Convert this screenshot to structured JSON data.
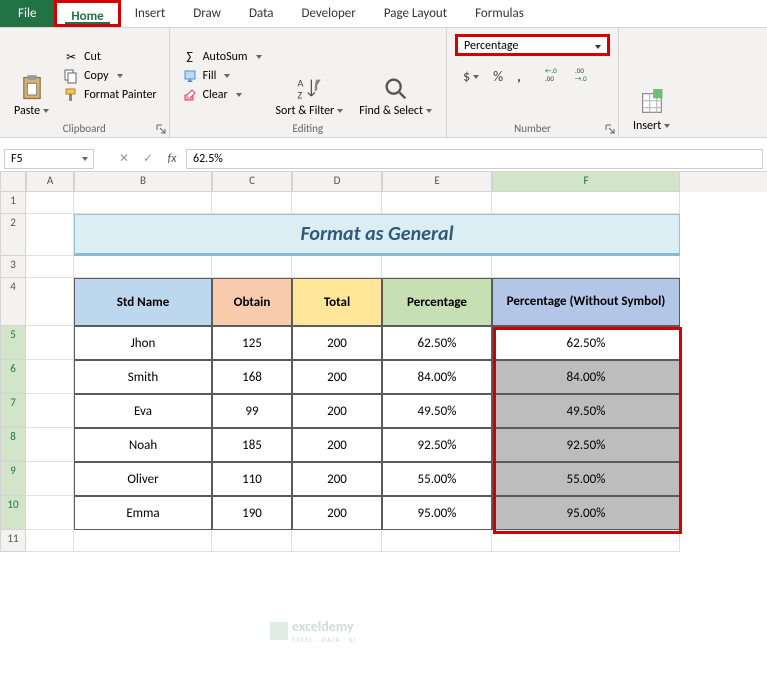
{
  "tabs": {
    "file": "File",
    "home": "Home",
    "insert": "Insert",
    "draw": "Draw",
    "data": "Data",
    "developer": "Developer",
    "pageLayout": "Page Layout",
    "formulas": "Formulas"
  },
  "clipboard": {
    "paste": "Paste",
    "cut": "Cut",
    "copy": "Copy",
    "formatPainter": "Format Painter",
    "label": "Clipboard"
  },
  "editing": {
    "autosum": "AutoSum",
    "fill": "Fill",
    "clear": "Clear",
    "sortFilter": "Sort & Filter",
    "findSelect": "Find & Select",
    "label": "Editing"
  },
  "number": {
    "format": "Percentage",
    "label": "Number",
    "currency": "$",
    "percent": "%",
    "comma": ",",
    "incDec": ".00→.0",
    "decDec": ".0→.00"
  },
  "cells": {
    "insert": "Insert"
  },
  "formula_bar": {
    "namebox": "F5",
    "value": "62.5%"
  },
  "columns": [
    "A",
    "B",
    "C",
    "D",
    "E",
    "F"
  ],
  "rows": [
    "1",
    "2",
    "3",
    "4",
    "5",
    "6",
    "7",
    "8",
    "9",
    "10",
    "11"
  ],
  "title": "Format as General",
  "headers": {
    "b": "Std Name",
    "c": "Obtain",
    "d": "Total",
    "e": "Percentage",
    "f": "Percentage (Without Symbol)"
  },
  "data": [
    {
      "name": "Jhon",
      "obtain": "125",
      "total": "200",
      "pct": "62.50%",
      "pct2": "62.50%"
    },
    {
      "name": "Smith",
      "obtain": "168",
      "total": "200",
      "pct": "84.00%",
      "pct2": "84.00%"
    },
    {
      "name": "Eva",
      "obtain": "99",
      "total": "200",
      "pct": "49.50%",
      "pct2": "49.50%"
    },
    {
      "name": "Noah",
      "obtain": "185",
      "total": "200",
      "pct": "92.50%",
      "pct2": "92.50%"
    },
    {
      "name": "Oliver",
      "obtain": "110",
      "total": "200",
      "pct": "55.00%",
      "pct2": "55.00%"
    },
    {
      "name": "Emma",
      "obtain": "190",
      "total": "200",
      "pct": "95.00%",
      "pct2": "95.00%"
    }
  ],
  "watermark": {
    "brand": "exceldemy",
    "tagline": "EXCEL · DATA · BI"
  }
}
